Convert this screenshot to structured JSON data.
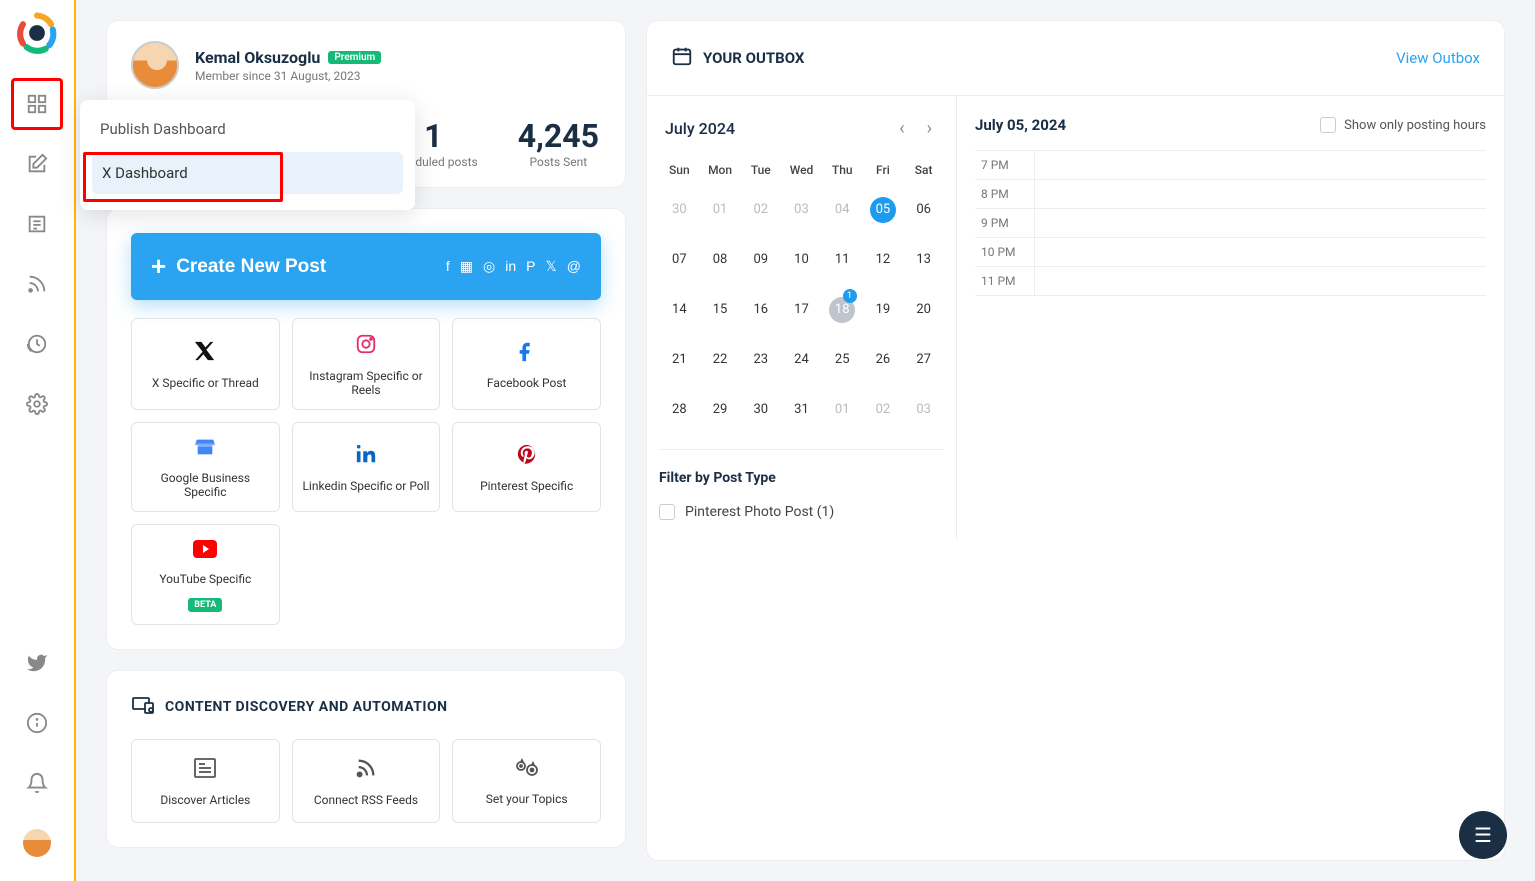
{
  "sidebar": {
    "nav": [
      "dashboard",
      "compose",
      "articles",
      "rss",
      "recycle",
      "settings"
    ]
  },
  "popup": {
    "title": "Publish Dashboard",
    "selected_item": "X Dashboard"
  },
  "profile": {
    "name": "Kemal Oksuzoglu",
    "badge": "Premium",
    "member_since": "Member since 31 August, 2023"
  },
  "stats": {
    "scheduled": {
      "value": "1",
      "label": "Scheduled posts"
    },
    "sent": {
      "value": "4,245",
      "label": "Posts Sent"
    }
  },
  "create": {
    "button": "Create New Post",
    "tiles": [
      {
        "icon": "x",
        "label": "X Specific or Thread",
        "color": "#111"
      },
      {
        "icon": "instagram",
        "label": "Instagram Specific or Reels",
        "color": "#e1306c"
      },
      {
        "icon": "facebook",
        "label": "Facebook Post",
        "color": "#1877f2"
      },
      {
        "icon": "gmb",
        "label": "Google Business Specific",
        "color": "#4285f4"
      },
      {
        "icon": "linkedin",
        "label": "Linkedin Specific or Poll",
        "color": "#0a66c2"
      },
      {
        "icon": "pinterest",
        "label": "Pinterest Specific",
        "color": "#bd081c"
      },
      {
        "icon": "youtube",
        "label": "YouTube Specific",
        "color": "#ff0000",
        "beta": "BETA"
      }
    ]
  },
  "content_section": {
    "title": "CONTENT DISCOVERY AND AUTOMATION",
    "tiles": [
      {
        "icon": "articles",
        "label": "Discover Articles"
      },
      {
        "icon": "rss",
        "label": "Connect RSS Feeds"
      },
      {
        "icon": "topics",
        "label": "Set your Topics"
      }
    ]
  },
  "outbox": {
    "title": "YOUR OUTBOX",
    "view_link": "View Outbox",
    "month_label": "July 2024",
    "dow": [
      "Sun",
      "Mon",
      "Tue",
      "Wed",
      "Thu",
      "Fri",
      "Sat"
    ],
    "days": [
      {
        "n": "30",
        "muted": true
      },
      {
        "n": "01",
        "muted": true
      },
      {
        "n": "02",
        "muted": true
      },
      {
        "n": "03",
        "muted": true
      },
      {
        "n": "04",
        "muted": true
      },
      {
        "n": "05",
        "selected": true
      },
      {
        "n": "06"
      },
      {
        "n": "07"
      },
      {
        "n": "08"
      },
      {
        "n": "09"
      },
      {
        "n": "10"
      },
      {
        "n": "11"
      },
      {
        "n": "12"
      },
      {
        "n": "13"
      },
      {
        "n": "14"
      },
      {
        "n": "15"
      },
      {
        "n": "16"
      },
      {
        "n": "17"
      },
      {
        "n": "18",
        "badge": "1",
        "badge_day": true
      },
      {
        "n": "19"
      },
      {
        "n": "20"
      },
      {
        "n": "21"
      },
      {
        "n": "22"
      },
      {
        "n": "23"
      },
      {
        "n": "24"
      },
      {
        "n": "25"
      },
      {
        "n": "26"
      },
      {
        "n": "27"
      },
      {
        "n": "28"
      },
      {
        "n": "29"
      },
      {
        "n": "30"
      },
      {
        "n": "31"
      },
      {
        "n": "01",
        "muted": true
      },
      {
        "n": "02",
        "muted": true
      },
      {
        "n": "03",
        "muted": true
      }
    ],
    "filter_title": "Filter by Post Type",
    "filter_item": "Pinterest Photo Post (1)",
    "selected_date": "July 05, 2024",
    "show_only_label": "Show only posting hours",
    "hours": [
      "7 PM",
      "8 PM",
      "9 PM",
      "10 PM",
      "11 PM"
    ]
  }
}
